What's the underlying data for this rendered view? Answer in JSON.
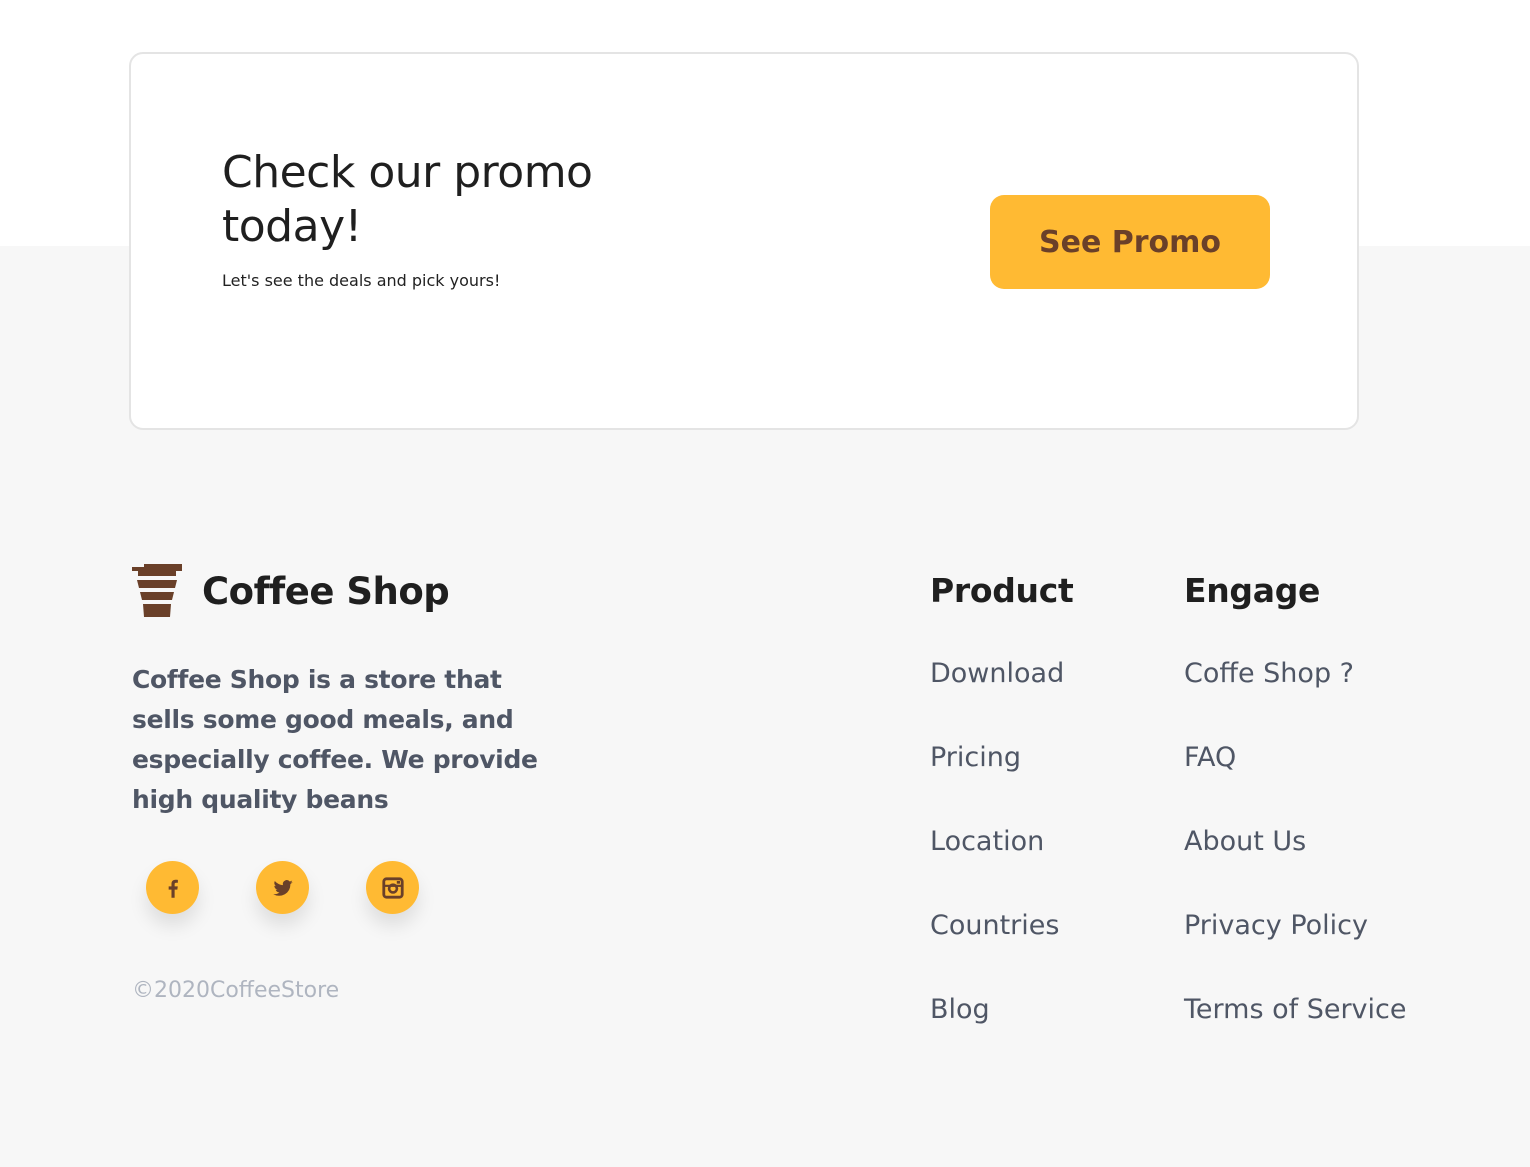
{
  "promo": {
    "title": "Check our promo today!",
    "subtitle": "Let's see the deals and pick yours!",
    "button_label": "See Promo"
  },
  "footer": {
    "brand_name": "Coffee Shop",
    "description": "Coffee Shop is a store that sells some good meals, and especially coffee. We provide high quality beans",
    "socials": [
      {
        "name": "facebook",
        "icon": "facebook-icon"
      },
      {
        "name": "twitter",
        "icon": "twitter-icon"
      },
      {
        "name": "instagram",
        "icon": "instagram-icon"
      }
    ],
    "copyright": "©2020CoffeeStore",
    "product": {
      "title": "Product",
      "links": [
        "Download",
        "Pricing",
        "Location",
        "Countries",
        "Blog"
      ]
    },
    "engage": {
      "title": "Engage",
      "links": [
        "Coffe Shop ?",
        "FAQ",
        "About Us",
        "Privacy Policy",
        "Terms of Service"
      ]
    }
  },
  "colors": {
    "accent": "#ffba33",
    "brand_brown": "#6a4029",
    "text_gray": "#4f5665",
    "muted_gray": "#afb5c0",
    "footer_bg": "#f7f7f7"
  }
}
